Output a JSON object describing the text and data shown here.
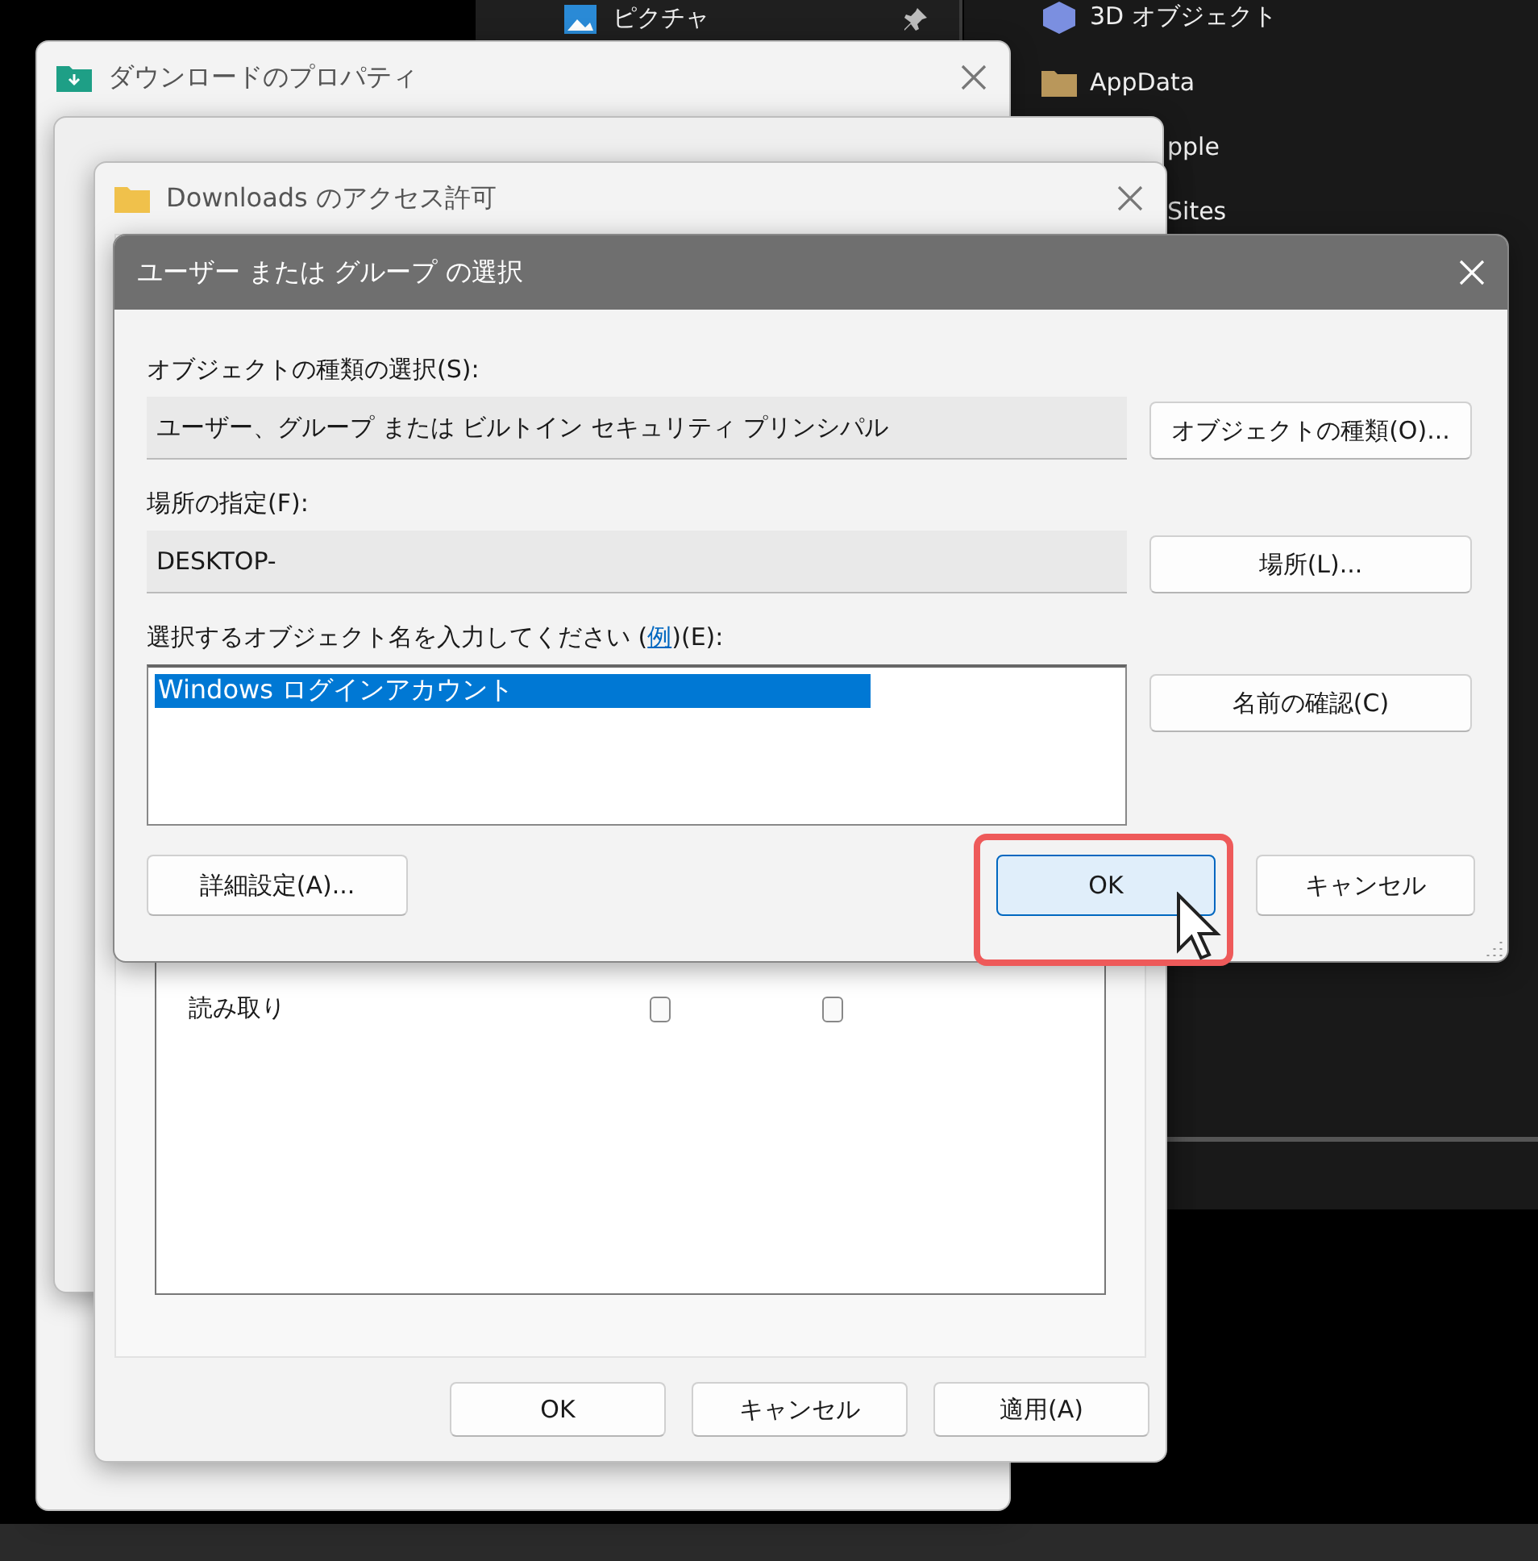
{
  "explorer": {
    "nav_items": [
      {
        "label": "ピクチャ",
        "pinned": true
      }
    ],
    "items": [
      {
        "label": "3D オブジェクト",
        "kind": "cube"
      },
      {
        "label": "AppData",
        "kind": "folder"
      },
      {
        "label": "pple",
        "kind": "plain"
      },
      {
        "label": "Sites",
        "kind": "plain"
      }
    ]
  },
  "properties_window": {
    "title": "ダウンロードのプロパティ"
  },
  "permissions_window": {
    "title": "Downloads のアクセス許可",
    "rows": [
      {
        "name": "読み取り",
        "allow": false,
        "deny": false
      }
    ],
    "buttons": [
      "OK",
      "キャンセル",
      "適用(A)"
    ]
  },
  "select_dialog": {
    "title": "ユーザー または グループ の選択",
    "object_type_label": "オブジェクトの種類の選択(S):",
    "object_type_value": "ユーザー、グループ または ビルトイン セキュリティ プリンシパル",
    "object_type_button": "オブジェクトの種類(O)...",
    "location_label": "場所の指定(F):",
    "location_value": "DESKTOP-",
    "location_button": "場所(L)...",
    "name_label_pre": "選択するオブジェクト名を入力してください (",
    "name_label_link": "例",
    "name_label_post": ")(E):",
    "name_value": "Windows ログインアカウント",
    "name_selected": true,
    "check_button": "名前の確認(C)",
    "advanced_button": "詳細設定(A)...",
    "ok_button": "OK",
    "cancel_button": "キャンセル",
    "ok_highlighted": true
  }
}
